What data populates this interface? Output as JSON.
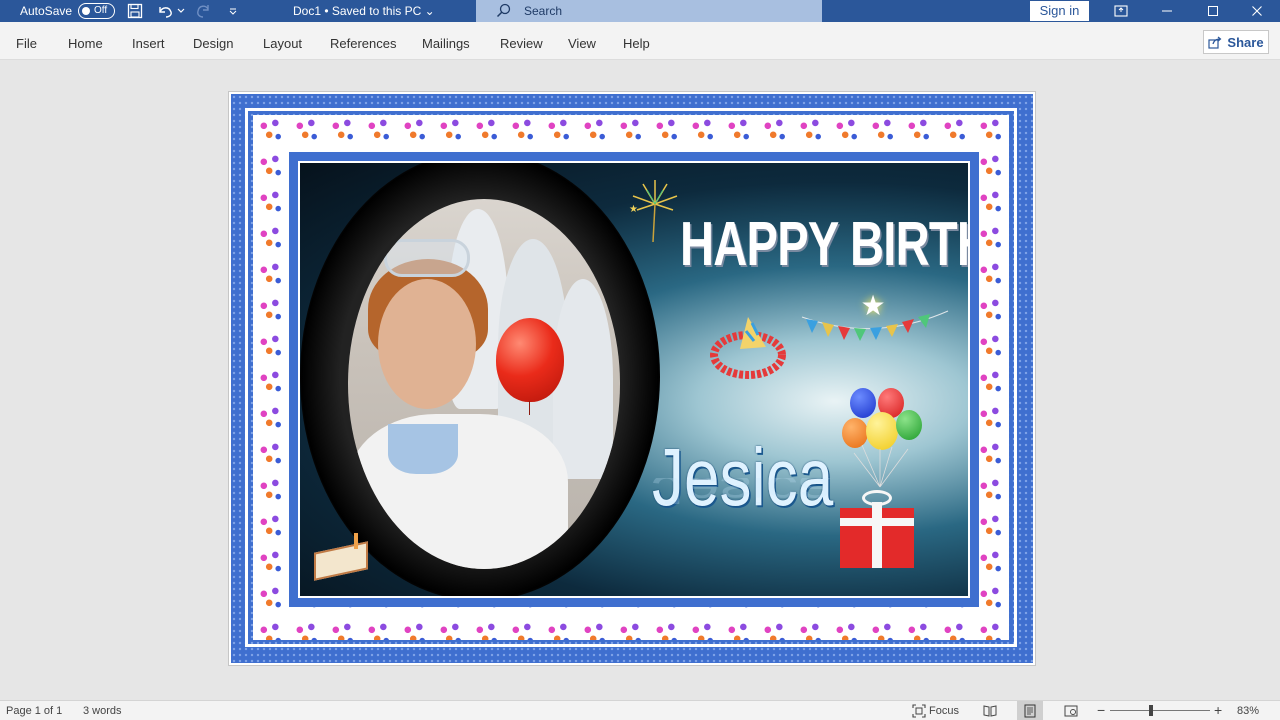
{
  "titlebar": {
    "autosave_label": "AutoSave",
    "autosave_state": "Off",
    "doc_title": "Doc1 • Saved to this PC ⌄",
    "search_placeholder": "Search",
    "sign_in": "Sign in",
    "accent": "#2b579a"
  },
  "menu": {
    "tabs": [
      "File",
      "Home",
      "Insert",
      "Design",
      "Layout",
      "References",
      "Mailings",
      "Review",
      "View",
      "Help"
    ],
    "share": "Share"
  },
  "document": {
    "headline": "HAPPY BIRTHDAY",
    "name": "Jesica",
    "frame_color": "#3f6fcf"
  },
  "status": {
    "page": "Page 1 of 1",
    "words": "3 words",
    "focus": "Focus",
    "zoom_percent": 83,
    "zoom_label": "83%"
  }
}
